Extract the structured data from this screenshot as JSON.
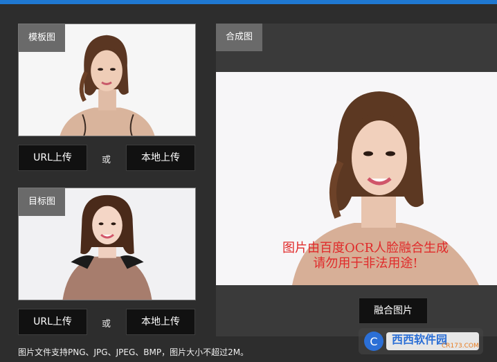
{
  "template": {
    "tag": "模板图",
    "url_upload": "URL上传",
    "or": "或",
    "local_upload": "本地上传"
  },
  "target": {
    "tag": "目标图",
    "url_upload": "URL上传",
    "or": "或",
    "local_upload": "本地上传"
  },
  "result": {
    "tag": "合成图",
    "watermark_line1": "图片由百度OCR人脸融合生成",
    "watermark_line2": "请勿用于非法用途!",
    "merge_button": "融合图片"
  },
  "footer": {
    "note": "图片文件支持PNG、JPG、JPEG、BMP，图片大小不超过2M。"
  },
  "logo": {
    "brand": "西西软件园",
    "url": "CR173.COM"
  },
  "colors": {
    "accent": "#1f78d1",
    "background": "#2d2d2d",
    "button": "#111111",
    "tag": "#6a6a6a",
    "watermark": "#e02a2a"
  }
}
